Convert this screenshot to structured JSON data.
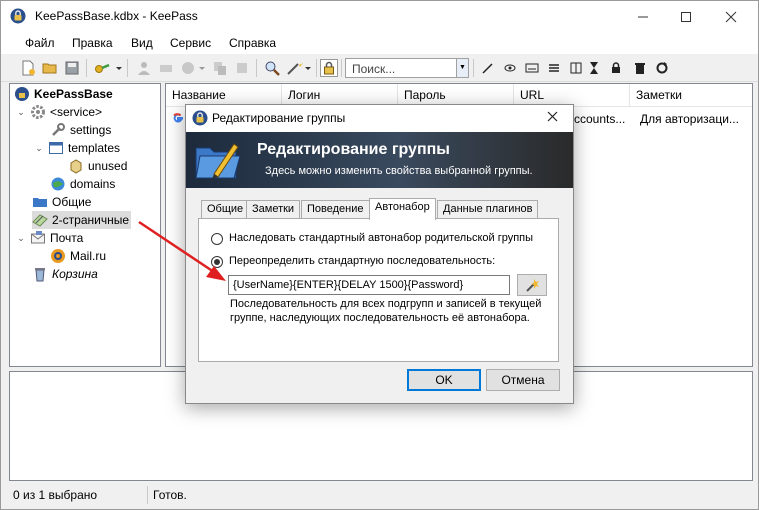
{
  "window": {
    "title": "KeePassBase.kdbx - KeePass"
  },
  "menu": [
    "Файл",
    "Правка",
    "Вид",
    "Сервис",
    "Справка"
  ],
  "toolbar": {
    "search_placeholder": "Поиск..."
  },
  "tree": {
    "root": "KeePassBase",
    "service": "<service>",
    "settings": "settings",
    "templates": "templates",
    "unused": "unused",
    "domains": "domains",
    "general": "Общие",
    "two_page": "2-страничные",
    "mail": "Почта",
    "mailru": "Mail.ru",
    "trash": "Корзина"
  },
  "list": {
    "columns": [
      "Название",
      "Логин",
      "Пароль",
      "URL",
      "Заметки"
    ],
    "row": {
      "url": "ccounts...",
      "notes": "Для авторизаци..."
    }
  },
  "status": {
    "count": "0 из 1 выбрано",
    "state": "Готов."
  },
  "dialog": {
    "title": "Редактирование группы",
    "banner_title": "Редактирование группы",
    "banner_subtitle": "Здесь можно изменить свойства выбранной группы.",
    "tabs": [
      "Общие",
      "Заметки",
      "Поведение",
      "Автонабор",
      "Данные плагинов"
    ],
    "active_tab": "Автонабор",
    "radio_inherit": "Наследовать стандартный автонабор родительской группы",
    "radio_override": "Переопределить стандартную последовательность:",
    "sequence": "{UserName}{ENTER}{DELAY 1500}{Password}",
    "hint": "Последовательность для всех подгрупп и записей в текущей группе, наследующих последовательность её автонабора.",
    "ok": "OK",
    "cancel": "Отмена"
  },
  "colors": {
    "accent": "#0078d7",
    "annotation_arrow": "#e02020"
  }
}
